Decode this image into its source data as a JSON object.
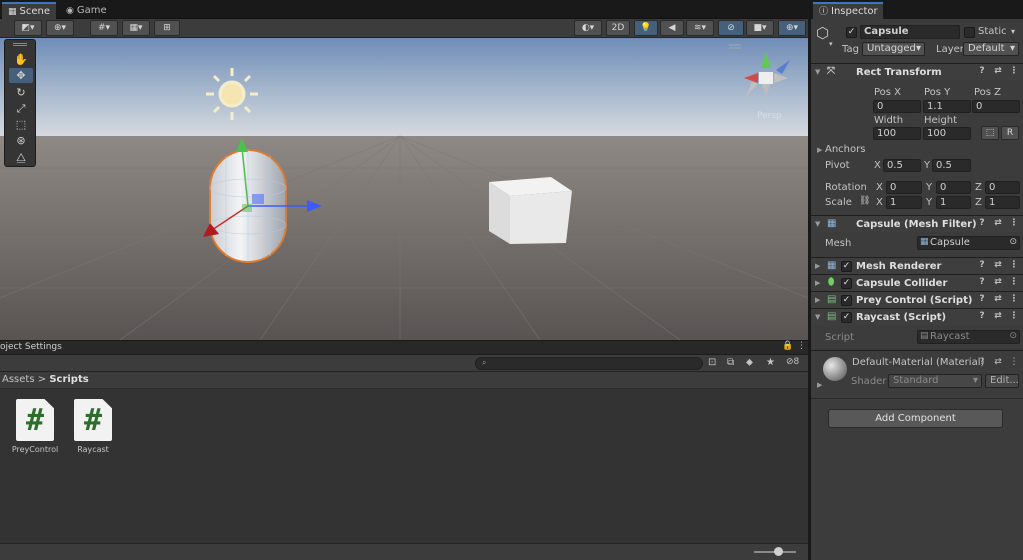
{
  "scene_tabs": [
    {
      "label": "Scene"
    },
    {
      "label": "Game"
    }
  ],
  "scene_toolbar": {
    "twod_label": "2D"
  },
  "viewport": {
    "projection_label": "Persp",
    "sky_color": "#7f97b8",
    "ground_color": "#6a6461"
  },
  "project": {
    "tab_label": "oject Settings",
    "search_placeholder": "",
    "hidden_count": "8",
    "breadcrumb": {
      "root": "Assets",
      "separator": ">",
      "current": "Scripts"
    },
    "assets": [
      {
        "label": "PreyControl"
      },
      {
        "label": "Raycast"
      }
    ]
  },
  "inspector": {
    "tab_label": "Inspector",
    "object_name": "Capsule",
    "static_label": "Static",
    "tag_label": "Tag",
    "tag_value": "Untagged",
    "layer_label": "Layer",
    "layer_value": "Default",
    "rect_transform": {
      "title": "Rect Transform",
      "pos_x_label": "Pos X",
      "pos_y_label": "Pos Y",
      "pos_z_label": "Pos Z",
      "pos_x": "0",
      "pos_y": "1.1",
      "pos_z": "0",
      "width_label": "Width",
      "height_label": "Height",
      "width": "100",
      "height": "100",
      "anchors_label": "Anchors",
      "pivot_label": "Pivot",
      "pivot_x": "0.5",
      "pivot_y": "0.5",
      "rotation_label": "Rotation",
      "rot_x": "0",
      "rot_y": "0",
      "rot_z": "0",
      "scale_label": "Scale",
      "scale_x": "1",
      "scale_y": "1",
      "scale_z": "1",
      "x_label": "X",
      "y_label": "Y",
      "z_label": "Z"
    },
    "mesh_filter": {
      "title": "Capsule (Mesh Filter)",
      "mesh_label": "Mesh",
      "mesh_value": "Capsule"
    },
    "components": [
      {
        "title": "Mesh Renderer"
      },
      {
        "title": "Capsule Collider"
      },
      {
        "title": "Prey Control (Script)"
      },
      {
        "title": "Raycast (Script)"
      }
    ],
    "raycast_script": {
      "label": "Script",
      "value": "Raycast"
    },
    "material": {
      "title": "Default-Material (Material)",
      "shader_label": "Shader",
      "shader_value": "Standard",
      "edit_label": "Edit..."
    },
    "add_component_label": "Add Component"
  }
}
